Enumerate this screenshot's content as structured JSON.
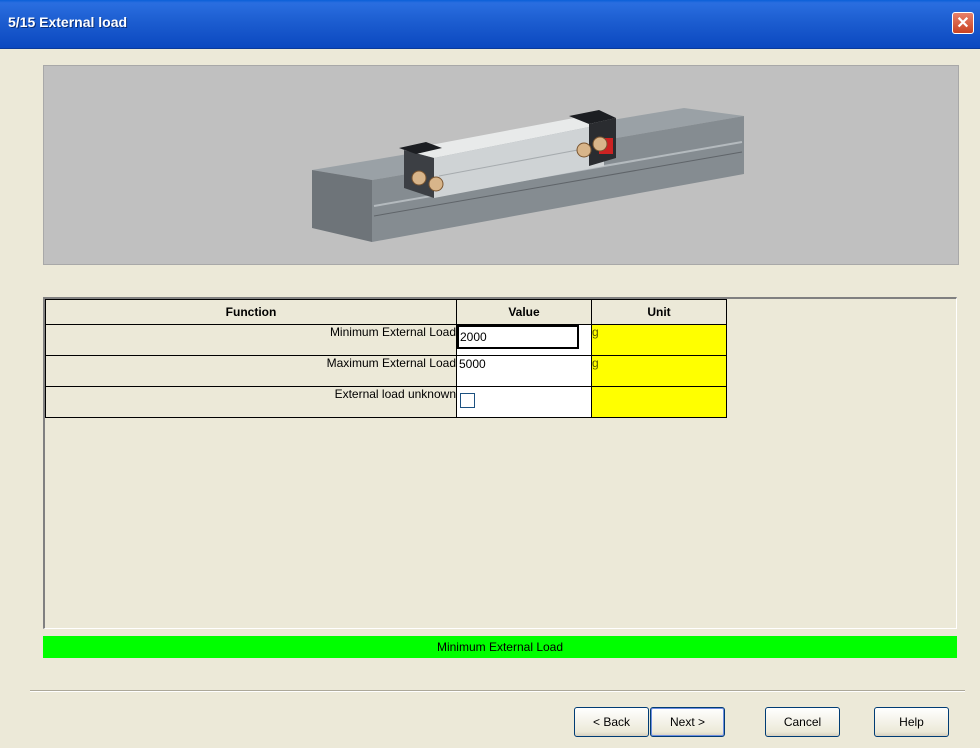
{
  "window": {
    "title": "5/15 External load",
    "close_glyph": "✕"
  },
  "preview": {
    "image": "linear-actuator-render"
  },
  "table": {
    "headers": {
      "function": "Function",
      "value": "Value",
      "unit": "Unit"
    },
    "rows": [
      {
        "function": "Minimum External Load",
        "value": "2000",
        "unit": "g"
      },
      {
        "function": "Maximum External Load",
        "value": "5000",
        "unit": "g"
      },
      {
        "function": "External load unknown",
        "value": "",
        "unit": "",
        "checked": false
      }
    ]
  },
  "status": {
    "text": "Minimum External Load",
    "color": "#00ff00"
  },
  "buttons": {
    "back": "< Back",
    "next": "Next >",
    "cancel": "Cancel",
    "help": "Help"
  },
  "colors": {
    "unit_cell": "#ffff00",
    "titlebar": "#0b48c0"
  }
}
